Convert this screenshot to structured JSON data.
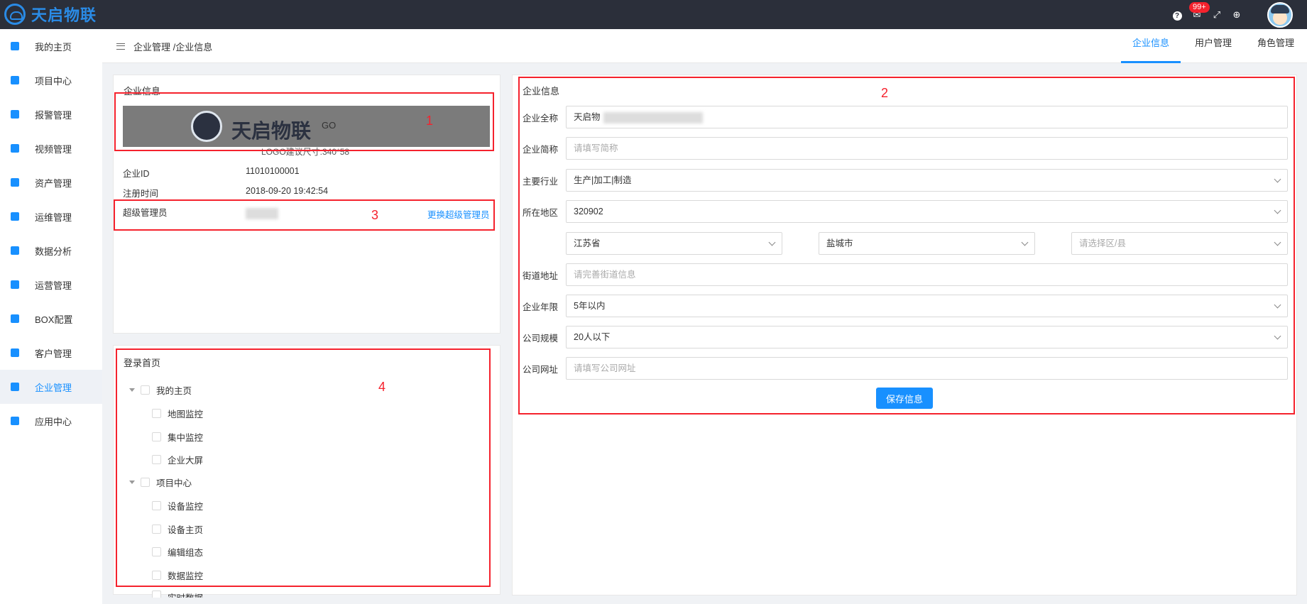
{
  "brand": {
    "name": "天启物联"
  },
  "topbar": {
    "notification_badge": "99+"
  },
  "sidebar": {
    "items": [
      {
        "label": "我的主页"
      },
      {
        "label": "项目中心"
      },
      {
        "label": "报警管理"
      },
      {
        "label": "视频管理"
      },
      {
        "label": "资产管理"
      },
      {
        "label": "运维管理"
      },
      {
        "label": "数据分析"
      },
      {
        "label": "运营管理"
      },
      {
        "label": "BOX配置"
      },
      {
        "label": "客户管理"
      },
      {
        "label": "企业管理"
      },
      {
        "label": "应用中心"
      }
    ]
  },
  "header": {
    "breadcrumb": "企业管理 /企业信息",
    "tabs": [
      {
        "label": "企业信息"
      },
      {
        "label": "用户管理"
      },
      {
        "label": "角色管理"
      }
    ]
  },
  "left_panel": {
    "title": "企业信息",
    "logo_text": "天启物联",
    "logo_suffix": "GO",
    "logo_hint": "LOGO建议尺寸:340*58",
    "id_label": "企业ID",
    "id_value": "11010100001",
    "reg_label": "注册时间",
    "reg_value": "2018-09-20 19:42:54",
    "admin_label": "超级管理员",
    "change_admin": "更换超级管理员"
  },
  "tree_panel": {
    "title": "登录首页",
    "nodes": [
      {
        "label": "我的主页"
      },
      {
        "label": "地图监控"
      },
      {
        "label": "集中监控"
      },
      {
        "label": "企业大屏"
      },
      {
        "label": "项目中心"
      },
      {
        "label": "设备监控"
      },
      {
        "label": "设备主页"
      },
      {
        "label": "编辑组态"
      },
      {
        "label": "数据监控"
      },
      {
        "label": "实时数据"
      }
    ]
  },
  "form": {
    "title": "企业信息",
    "full_name_label": "企业全称",
    "full_name_value": "天启物",
    "short_name_label": "企业简称",
    "short_name_placeholder": "请填写简称",
    "industry_label": "主要行业",
    "industry_value": "生产|加工|制造",
    "region_label": "所在地区",
    "region_code": "320902",
    "province": "江苏省",
    "city": "盐城市",
    "district_placeholder": "请选择区/县",
    "street_label": "街道地址",
    "street_placeholder": "请完善街道信息",
    "years_label": "企业年限",
    "years_value": "5年以内",
    "scale_label": "公司规模",
    "scale_value": "20人以下",
    "website_label": "公司网址",
    "website_placeholder": "请填写公司网址",
    "save_label": "保存信息"
  },
  "annotations": [
    "1",
    "2",
    "3",
    "4"
  ]
}
